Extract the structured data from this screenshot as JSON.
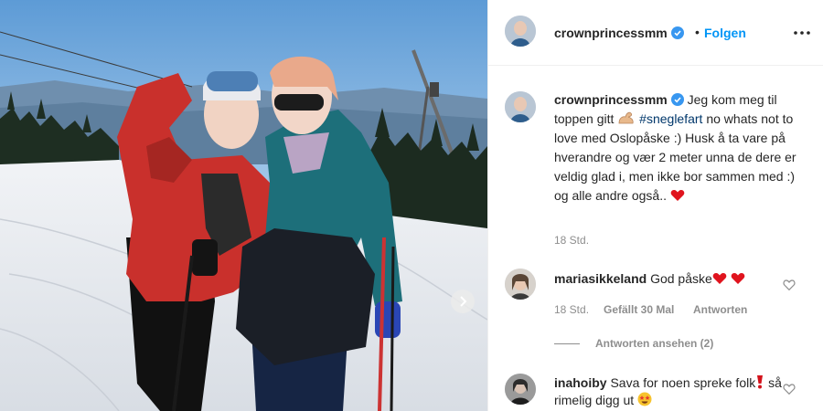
{
  "post": {
    "username": "crownprincessmm",
    "follow_label": "Folgen",
    "dot": "•",
    "more_icon": "more-horizontal-icon",
    "verified_color": "#3897f0",
    "link_color": "#0095f6"
  },
  "caption": {
    "username": "crownprincessmm",
    "text_1": "Jeg kom meg til toppen gitt",
    "emoji_1": "flexed-biceps",
    "hashtag": "#sneglefart",
    "text_2": "no whats not to love med Oslopåske :) Husk å ta vare på hverandre og vær 2 meter unna de dere er veldig glad i, men ikke bor sammen med :) og alle andre også..",
    "emoji_2": "red-heart",
    "time": "18 Std."
  },
  "comments": [
    {
      "username": "mariasikkeland",
      "text": "God påske",
      "emojis": [
        "red-heart",
        "red-heart"
      ],
      "time": "18 Std.",
      "likes": "Gefällt 30 Mal",
      "reply_label": "Antworten",
      "view_replies": "Antworten ansehen (2)"
    },
    {
      "username": "inahoiby",
      "text_1": "Sava for noen spreke folk",
      "emoji_1": "heavy-exclamation-mark",
      "text_2": "så rimelig digg ut",
      "emoji_2": "star-struck"
    }
  ],
  "carousel": {
    "next_icon": "chevron-right-icon"
  }
}
